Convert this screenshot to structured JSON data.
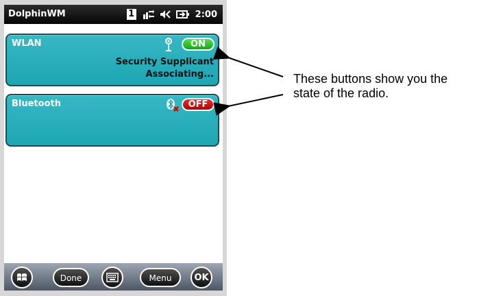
{
  "status_bar": {
    "app_name": "DolphinWM",
    "sim_number": "1",
    "time": "2:00",
    "icons": [
      "sim-icon",
      "data-connection-icon",
      "volume-icon",
      "battery-charging-icon"
    ]
  },
  "radios": [
    {
      "title": "WLAN",
      "icon": "wifi-antenna-icon",
      "toggle_label": "ON",
      "toggle_color": "#22b822",
      "line1": "Security Supplicant",
      "line2": "Associating..."
    },
    {
      "title": "Bluetooth",
      "icon": "bluetooth-disabled-icon",
      "toggle_label": "OFF",
      "toggle_color": "#cc1111"
    }
  ],
  "card_color": "#2aaebb",
  "bottom_bar": {
    "done_label": "Done",
    "menu_label": "Menu",
    "ok_label": "OK",
    "icons": [
      "windows-start-icon",
      "keyboard-icon"
    ]
  },
  "annotation": {
    "line1": "These buttons show you the",
    "line2": "state of the radio."
  }
}
